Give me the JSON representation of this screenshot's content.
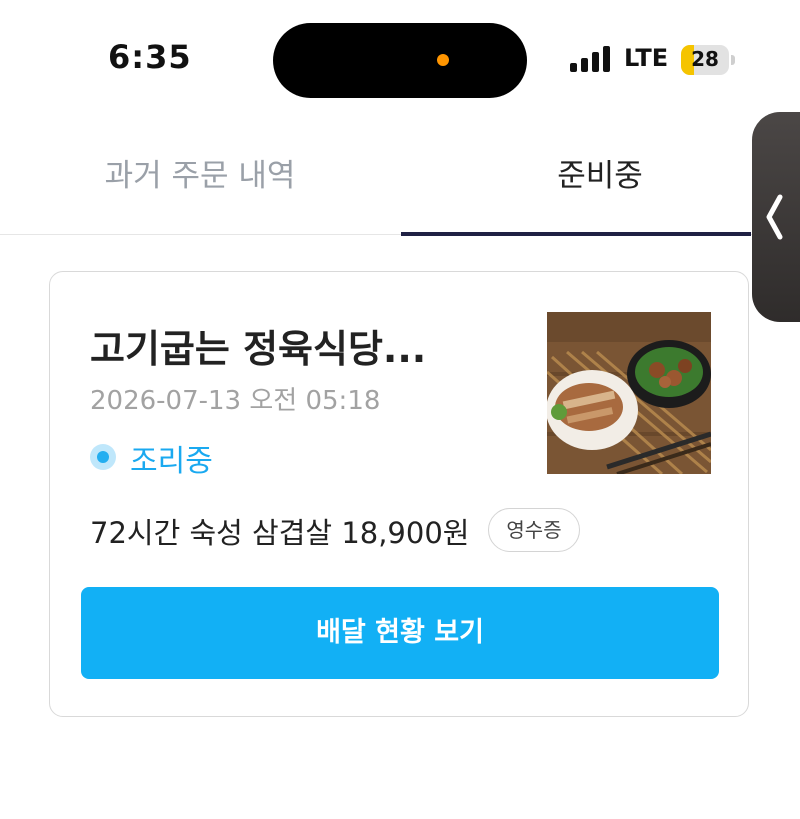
{
  "status_bar": {
    "time": "6:35",
    "network": "LTE",
    "battery_level": "28",
    "battery_color": "#f5c400",
    "recording_indicator_color": "#ff9500"
  },
  "tabs": [
    {
      "label": "과거 주문 내역",
      "active": false
    },
    {
      "label": "준비중",
      "active": true
    }
  ],
  "order": {
    "store_name": "고기굽는 정육식당...",
    "order_time": "2026-07-13 오전 05:18",
    "status": "조리중",
    "summary": "72시간 숙성 삼겹살 18,900원",
    "receipt_label": "영수증",
    "track_button_label": "배달 현황 보기",
    "image_icon": "food-photo"
  },
  "colors": {
    "accent": "#12b0f5",
    "status_text": "#1aa9f0",
    "tab_underline": "#1f2144"
  }
}
